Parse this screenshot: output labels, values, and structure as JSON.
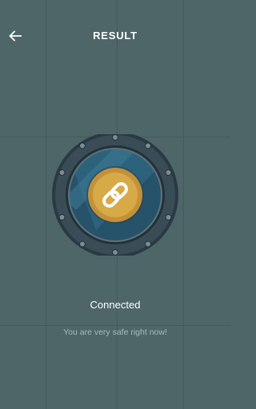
{
  "header": {
    "title": "RESULT",
    "back_icon": "arrow-left-icon"
  },
  "result": {
    "status_text": "Connected",
    "message": "You are very safe right now!",
    "center_icon": "link-icon"
  },
  "colors": {
    "background": "#4e6668",
    "accent": "#d8a947",
    "frame": "#3a4d57"
  }
}
